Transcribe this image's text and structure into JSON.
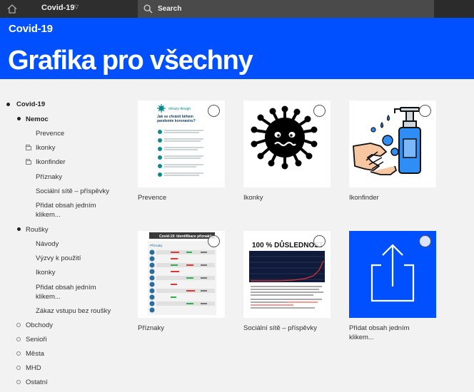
{
  "topbar": {
    "context": "Covid-19",
    "search_placeholder": "Search"
  },
  "header": {
    "subtitle": "Covid-19",
    "title": "Grafika pro všechny"
  },
  "tree": {
    "root": "Covid-19",
    "nemoc": "Nemoc",
    "nemoc_items": [
      "Prevence",
      "Ikonky",
      "Ikonfinder",
      "Příznaky",
      "Sociální sítě – příspěvky",
      "Přidat obsah jedním",
      "klikem..."
    ],
    "rousky": "Roušky",
    "rousky_items": [
      "Návody",
      "Výzvy k použití",
      "Ikonky",
      "Přidat obsah jedním",
      "klikem...",
      "Zákaz vstupu bez roušky"
    ],
    "others": [
      "Obchody",
      "Senioři",
      "Města",
      "MHD",
      "Ostatní"
    ]
  },
  "cards": [
    {
      "caption": "Prevence"
    },
    {
      "caption": "Ikonky"
    },
    {
      "caption": "Ikonfinder"
    },
    {
      "caption": "Příznaky"
    },
    {
      "caption": "Sociální sítě – příspěvky"
    },
    {
      "caption": "Přidat obsah jedním",
      "caption2": "klikem..."
    }
  ],
  "thumbs": {
    "prevence_brand": "ohrazy design",
    "prevence_heading": "Jak se chránit během pandemie koronaviru?",
    "priznaky_heading": "Covid-19: Identifikace příznaků",
    "priznaky_col": "Příznaky",
    "socialni_heading": "100 % DŮSLEDNOST"
  },
  "colors": {
    "accent": "#0050ff",
    "topbar": "#2b2b2b",
    "search": "#4a4a4a"
  }
}
